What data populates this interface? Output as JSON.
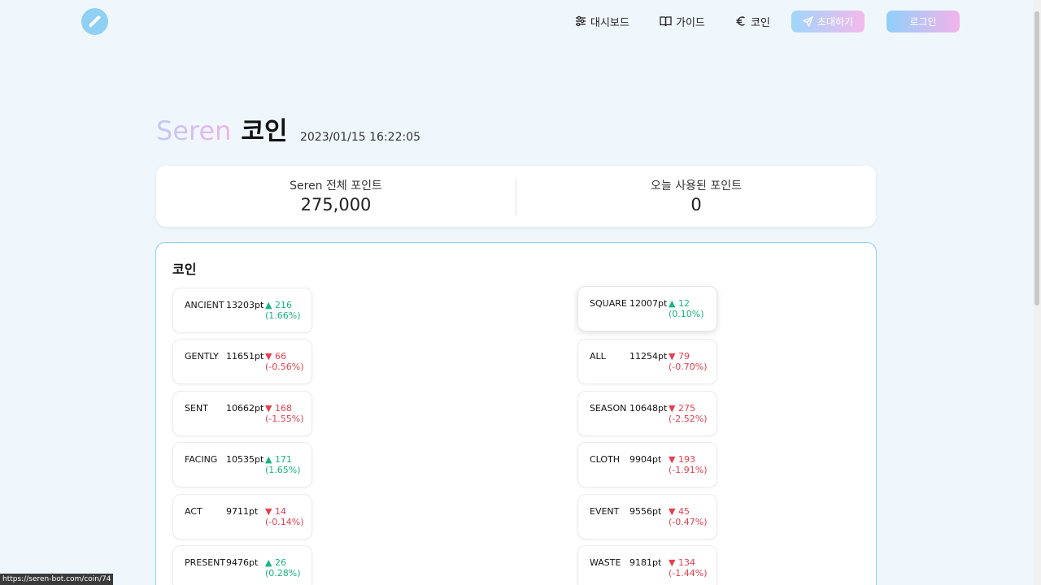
{
  "header": {
    "nav": [
      {
        "label": "대시보드",
        "icon": "sliders-icon"
      },
      {
        "label": "가이드",
        "icon": "book-icon"
      },
      {
        "label": "코인",
        "icon": "euro-icon"
      }
    ],
    "invite_label": "초대하기",
    "login_label": "로그인"
  },
  "title": {
    "brand": "Seren",
    "text": "코인",
    "date": "2023/01/15 16:22:05"
  },
  "points": {
    "total_label": "Seren 전체 포인트",
    "total_value": "275,000",
    "today_label": "오늘 사용된 포인트",
    "today_value": "0"
  },
  "coins": {
    "heading": "코인",
    "left": [
      {
        "name": "ANCIENT",
        "price": "13203pt",
        "change": "▲ 216",
        "pct": "(1.66%)",
        "dir": "up"
      },
      {
        "name": "GENTLY",
        "price": "11651pt",
        "change": "▼ 66",
        "pct": "(-0.56%)",
        "dir": "down"
      },
      {
        "name": "SENT",
        "price": "10662pt",
        "change": "▼ 168",
        "pct": "(-1.55%)",
        "dir": "down"
      },
      {
        "name": "FACING",
        "price": "10535pt",
        "change": "▲ 171",
        "pct": "(1.65%)",
        "dir": "up"
      },
      {
        "name": "ACT",
        "price": "9711pt",
        "change": "▼ 14",
        "pct": "(-0.14%)",
        "dir": "down"
      },
      {
        "name": "PRESENT",
        "price": "9476pt",
        "change": "▲ 26",
        "pct": "(0.28%)",
        "dir": "up"
      }
    ],
    "right": [
      {
        "name": "SQUARE",
        "price": "12007pt",
        "change": "▲ 12",
        "pct": "(0.10%)",
        "dir": "up"
      },
      {
        "name": "ALL",
        "price": "11254pt",
        "change": "▼ 79",
        "pct": "(-0.70%)",
        "dir": "down"
      },
      {
        "name": "SEASON",
        "price": "10648pt",
        "change": "▼ 275",
        "pct": "(-2.52%)",
        "dir": "down"
      },
      {
        "name": "CLOTH",
        "price": "9904pt",
        "change": "▼ 193",
        "pct": "(-1.91%)",
        "dir": "down"
      },
      {
        "name": "EVENT",
        "price": "9556pt",
        "change": "▼ 45",
        "pct": "(-0.47%)",
        "dir": "down"
      },
      {
        "name": "WASTE",
        "price": "9181pt",
        "change": "▼ 134",
        "pct": "(-1.44%)",
        "dir": "down"
      }
    ]
  },
  "colors": {
    "up": "#17b47f",
    "down": "#e5404f",
    "panel_border": "#8cd2f2",
    "background": "#eff7fd"
  },
  "status_url": "https://seren-bot.com/coin/74"
}
